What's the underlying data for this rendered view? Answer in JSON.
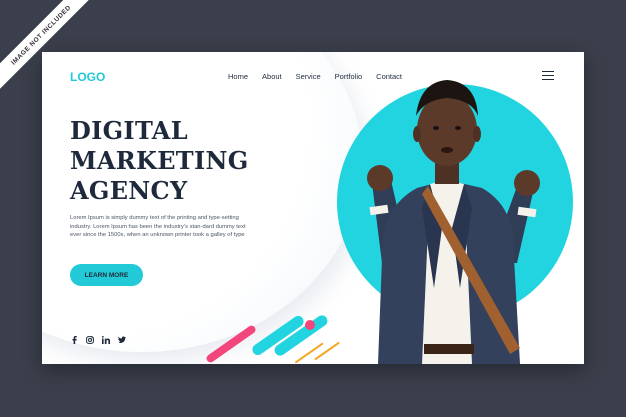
{
  "watermark": "IMAGE NOT INCLUDED",
  "logo": "LOGO",
  "nav": [
    "Home",
    "About",
    "Service",
    "Portfolio",
    "Contact"
  ],
  "hero": {
    "line1": "DIGITAL",
    "line2": "MARKETING",
    "line3": "AGENCY",
    "body": "Lorem Ipsum is simply dummy text of the printing and type-setting industry. Lorem Ipsum has been the industry's stan-dard dummy text ever since the 1500s, when an unknown printer took a galley of type",
    "cta": "LEARN MORE"
  },
  "social_icons": [
    "facebook-icon",
    "instagram-icon",
    "linkedin-icon",
    "twitter-icon"
  ],
  "colors": {
    "accent": "#22c9d6",
    "pink": "#f2467d",
    "orange": "#f5a623",
    "dark": "#1e2a3b",
    "frame": "#3a3f4b"
  }
}
